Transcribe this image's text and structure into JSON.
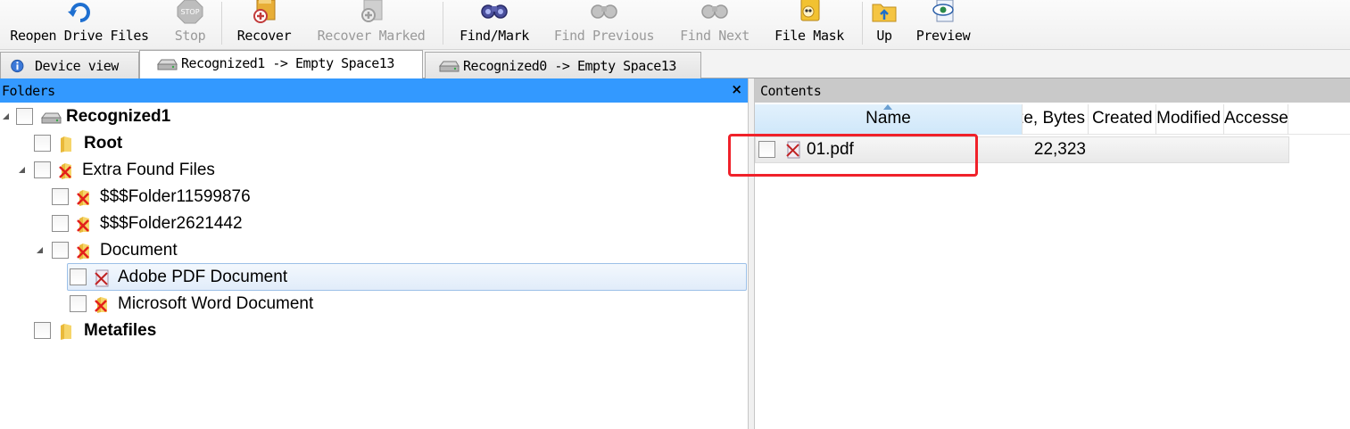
{
  "toolbar": {
    "reopen_label": "Reopen Drive Files",
    "stop_label": "Stop",
    "recover_label": "Recover",
    "recover_marked_label": "Recover Marked",
    "find_mark_label": "Find/Mark",
    "find_previous_label": "Find Previous",
    "find_next_label": "Find Next",
    "file_mask_label": "File Mask",
    "up_label": "Up",
    "preview_label": "Preview"
  },
  "tabs": {
    "device_view": "Device view",
    "recognized1": "Recognized1 -> Empty Space13",
    "recognized0": "Recognized0 -> Empty Space13"
  },
  "folders_panel": {
    "title": "Folders",
    "close_glyph": "×",
    "tree": {
      "recognized1": "Recognized1",
      "root": "Root",
      "extra_found": "Extra Found Files",
      "folder1": "$$$Folder11599876",
      "folder2": "$$$Folder2621442",
      "document": "Document",
      "adobe_pdf": "Adobe PDF Document",
      "ms_word": "Microsoft Word Document",
      "metafiles": "Metafiles"
    }
  },
  "contents_panel": {
    "title": "Contents",
    "columns": {
      "name": "Name",
      "size": "Size, Bytes",
      "created": "Created",
      "modified": "Modified",
      "accessed": "Accessed"
    },
    "files": [
      {
        "name": "01.pdf",
        "size": "22,323"
      }
    ]
  },
  "colors": {
    "selection_header": "#3399ff",
    "highlight_box": "#f0212a"
  }
}
